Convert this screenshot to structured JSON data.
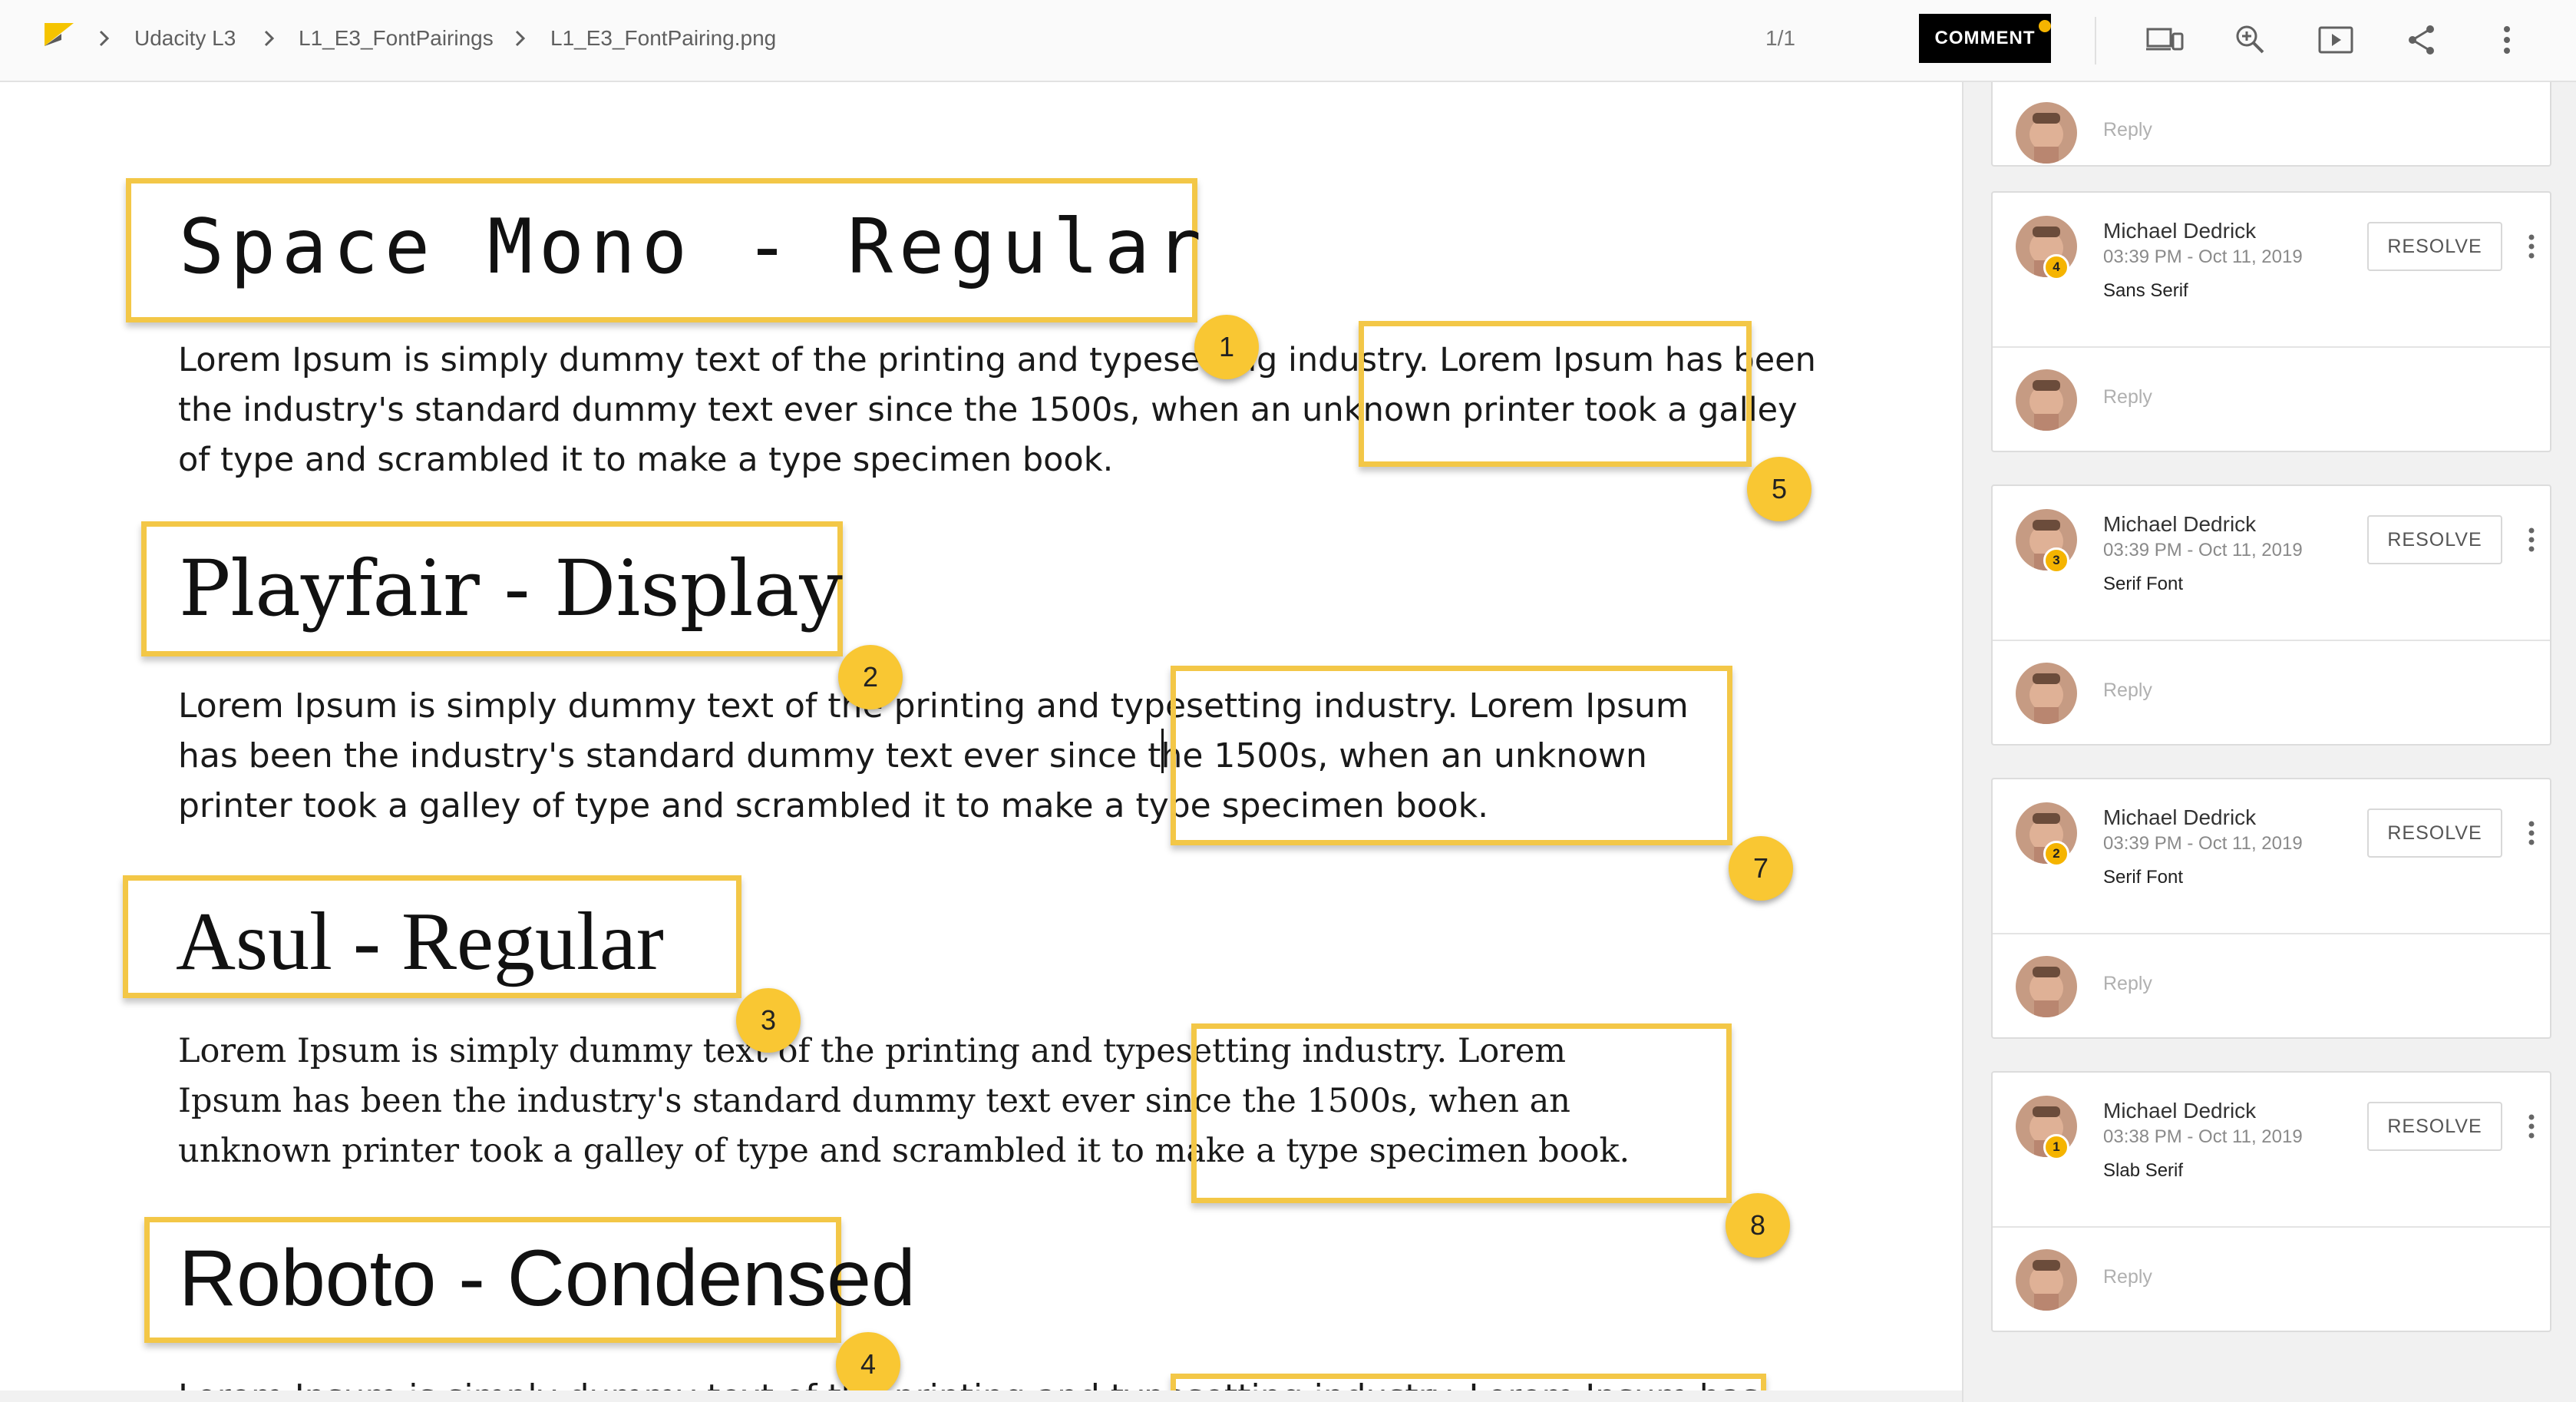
{
  "header": {
    "breadcrumbs": [
      "Udacity L3",
      "L1_E3_FontPairings",
      "L1_E3_FontPairing.png"
    ],
    "page_count": "1/1",
    "comment_label": "COMMENT",
    "accent_color": "#f3c747"
  },
  "canvas": {
    "sections": [
      {
        "title": "Space Mono - Regular",
        "lines": [
          "Lorem Ipsum is simply dummy text of the printing and typesetting industry. Lorem Ipsum has been",
          "the industry's standard dummy text ever since the 1500s, when an unknown printer took a galley",
          "of type and scrambled it to make a type specimen book."
        ]
      },
      {
        "title": "Playfair - Display",
        "lines": [
          "Lorem Ipsum is simply dummy text of the printing and typesetting industry. Lorem Ipsum",
          "has been the industry's standard dummy text ever since the 1500s, when an unknown",
          "printer took a galley of type and scrambled it to make a type specimen book."
        ]
      },
      {
        "title": "Asul - Regular",
        "lines": [
          "Lorem Ipsum is simply dummy text of the printing and typesetting industry. Lorem",
          "Ipsum has been the industry's standard dummy text ever since the 1500s, when an",
          "unknown printer took a galley of type and scrambled it to make a type specimen book."
        ]
      },
      {
        "title": "Roboto - Condensed",
        "lines": [
          "Lorem Ipsum is simply dummy text of the printing and typesetting industry. Lorem Ipsum has"
        ]
      }
    ],
    "markers": [
      "1",
      "2",
      "3",
      "4",
      "5",
      "7",
      "8"
    ]
  },
  "comments": {
    "reply_placeholder": "Reply",
    "resolve_label": "RESOLVE",
    "threads": [
      {
        "author": "Michael Dedrick",
        "time": "03:39 PM - Oct 11, 2019",
        "text": "Sans Serif",
        "badge": "4"
      },
      {
        "author": "Michael Dedrick",
        "time": "03:39 PM - Oct 11, 2019",
        "text": "Serif Font",
        "badge": "3"
      },
      {
        "author": "Michael Dedrick",
        "time": "03:39 PM - Oct 11, 2019",
        "text": "Serif Font",
        "badge": "2"
      },
      {
        "author": "Michael Dedrick",
        "time": "03:38 PM - Oct 11, 2019",
        "text": "Slab Serif",
        "badge": "1"
      }
    ]
  }
}
